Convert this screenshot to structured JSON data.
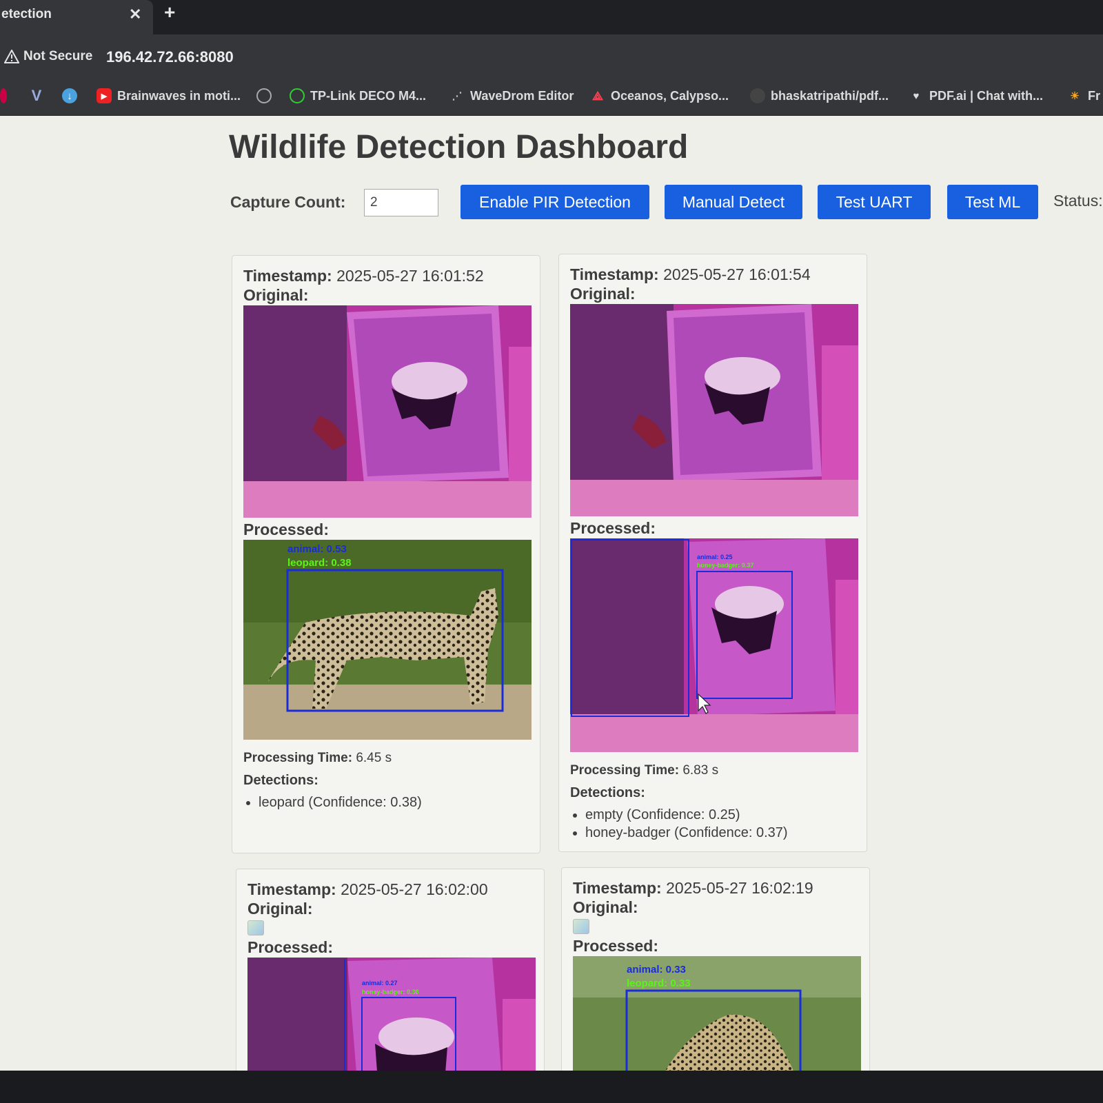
{
  "browser": {
    "tab_title": "etection",
    "tab_close": "✕",
    "new_tab": "+",
    "security_label": "Not Secure",
    "url": "196.42.72.66:8080",
    "bookmarks": [
      "Brainwaves in moti...",
      "TP-Link DECO M4...",
      "WaveDrom Editor",
      "Oceanos, Calypso...",
      "bhaskatripathi/pdf...",
      "PDF.ai | Chat with...",
      "Fr"
    ]
  },
  "page": {
    "title": "Wildlife Detection Dashboard",
    "capture_count_label": "Capture Count:",
    "capture_count_value": "2",
    "buttons": {
      "enable_pir": "Enable PIR Detection",
      "manual_detect": "Manual Detect",
      "test_uart": "Test UART",
      "test_ml": "Test ML"
    },
    "status_label": "Status:"
  },
  "labels": {
    "timestamp": "Timestamp:",
    "original": "Original:",
    "processed": "Processed:",
    "processing_time": "Processing Time:",
    "detections": "Detections:"
  },
  "cards": [
    {
      "timestamp": "2025-05-27 16:01:52",
      "processing_time": "6.45 s",
      "overlay_1": "animal: 0.53",
      "overlay_2": "leopard: 0.38",
      "detections": [
        "leopard (Confidence: 0.38)"
      ]
    },
    {
      "timestamp": "2025-05-27 16:01:54",
      "processing_time": "6.83 s",
      "overlay_1": "animal: 0.25",
      "overlay_2": "honey-badger: 0.37",
      "detections": [
        "empty (Confidence: 0.25)",
        "honey-badger (Confidence: 0.37)"
      ]
    },
    {
      "timestamp": "2025-05-27 16:02:00",
      "overlay_1": "animal: 0.27",
      "overlay_2": "honey-badger: 0.38"
    },
    {
      "timestamp": "2025-05-27 16:02:19",
      "overlay_1": "animal: 0.33",
      "overlay_2": "leopard: 0.33"
    }
  ],
  "colors": {
    "button": "#1860e0",
    "page_bg": "#efefea",
    "box_blue": "#1a2cd8",
    "label_green": "#5cf21a"
  },
  "icons": [
    "warning-icon",
    "close-icon",
    "plus-icon",
    "cursor-icon"
  ]
}
